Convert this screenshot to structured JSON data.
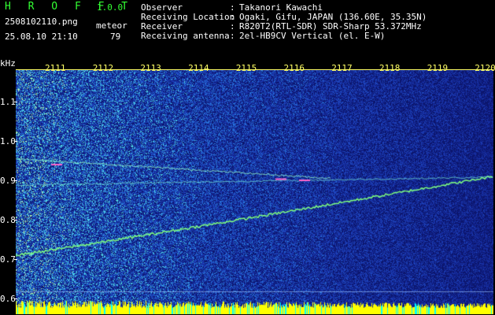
{
  "app": {
    "title": "H R O F F T",
    "version": "1.0.0",
    "file_name": "2508102110.png",
    "meteor_label": "meteor",
    "date_time": "25.08.10 21:10",
    "meteor_count": "79"
  },
  "info": [
    {
      "key": "Observer",
      "value": "Takanori Kawachi"
    },
    {
      "key": "Receiving Location",
      "value": "Ogaki, Gifu, JAPAN (136.60E, 35.35N)"
    },
    {
      "key": "Receiver",
      "value": "R820T2(RTL-SDR) SDR-Sharp 53.372MHz"
    },
    {
      "key": "Receiving antenna",
      "value": "2el-HB9CV Vertical (el. E-W)"
    }
  ],
  "info_separator": ":",
  "axis": {
    "unit": "kHz",
    "time_ticks": [
      "2111",
      "2112",
      "2113",
      "2114",
      "2115",
      "2116",
      "2117",
      "2118",
      "2119",
      "2120"
    ],
    "freq_ticks": [
      {
        "label": "1.1",
        "value": 1.1
      },
      {
        "label": "1.0",
        "value": 1.0
      },
      {
        "label": "0.9",
        "value": 0.9
      },
      {
        "label": "0.8",
        "value": 0.8
      },
      {
        "label": "0.7",
        "value": 0.7
      },
      {
        "label": "0.6",
        "value": 0.6
      }
    ]
  },
  "colors": {
    "title_green": "#33ff33",
    "tick_yellow": "#ffff66",
    "background": "#1c2b8a",
    "noise_base": "#1f2fa0",
    "trace_green": "#7fff7f",
    "meteor_magenta": "#ff66cc",
    "bottom_bar": "#ffff00"
  }
}
